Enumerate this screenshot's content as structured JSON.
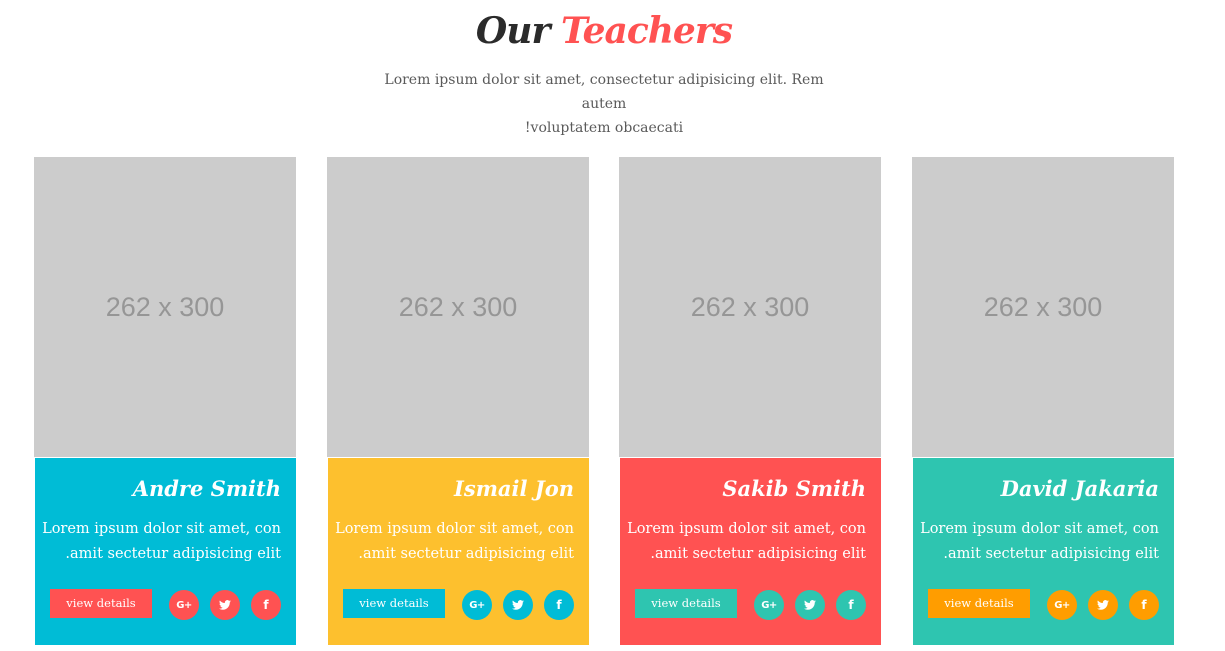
{
  "header": {
    "title_part1": "Our",
    "title_part2": "Teachers",
    "subtitle_line1": "Lorem ipsum dolor sit amet, consectetur adipisicing elit. Rem autem",
    "subtitle_line2": "!voluptatem obcaecati"
  },
  "colors": {
    "title_dark": "#2b2b2b",
    "title_accent": "#ff5252",
    "placeholder_bg": "#cccccc"
  },
  "teachers": [
    {
      "photo_placeholder": "262 x 300",
      "name": "Andre Smith",
      "desc_line1": "Lorem ipsum dolor sit amet, con",
      "desc_line2": ".amit sectetur adipisicing elit",
      "button_label": "view details",
      "social": {
        "google": "G+",
        "twitter": "twitter-icon",
        "facebook": "f"
      },
      "card_color": "#00bcd6",
      "button_color": "#ff5252",
      "social_color": "#ff5252"
    },
    {
      "photo_placeholder": "262 x 300",
      "name": "Ismail Jon",
      "desc_line1": "Lorem ipsum dolor sit amet, con",
      "desc_line2": ".amit sectetur adipisicing elit",
      "button_label": "view details",
      "social": {
        "google": "G+",
        "twitter": "twitter-icon",
        "facebook": "f"
      },
      "card_color": "#fdc02e",
      "button_color": "#00bcd6",
      "social_color": "#00bcd6"
    },
    {
      "photo_placeholder": "262 x 300",
      "name": "Sakib Smith",
      "desc_line1": "Lorem ipsum dolor sit amet, con",
      "desc_line2": ".amit sectetur adipisicing elit",
      "button_label": "view details",
      "social": {
        "google": "G+",
        "twitter": "twitter-icon",
        "facebook": "f"
      },
      "card_color": "#ff5252",
      "button_color": "#2ec5b0",
      "social_color": "#2ec5b0"
    },
    {
      "photo_placeholder": "262 x 300",
      "name": "David Jakaria",
      "desc_line1": "Lorem ipsum dolor sit amet, con",
      "desc_line2": ".amit sectetur adipisicing elit",
      "button_label": "view details",
      "social": {
        "google": "G+",
        "twitter": "twitter-icon",
        "facebook": "f"
      },
      "card_color": "#2ec5b0",
      "button_color": "#ff9d00",
      "social_color": "#ff9d00"
    }
  ]
}
